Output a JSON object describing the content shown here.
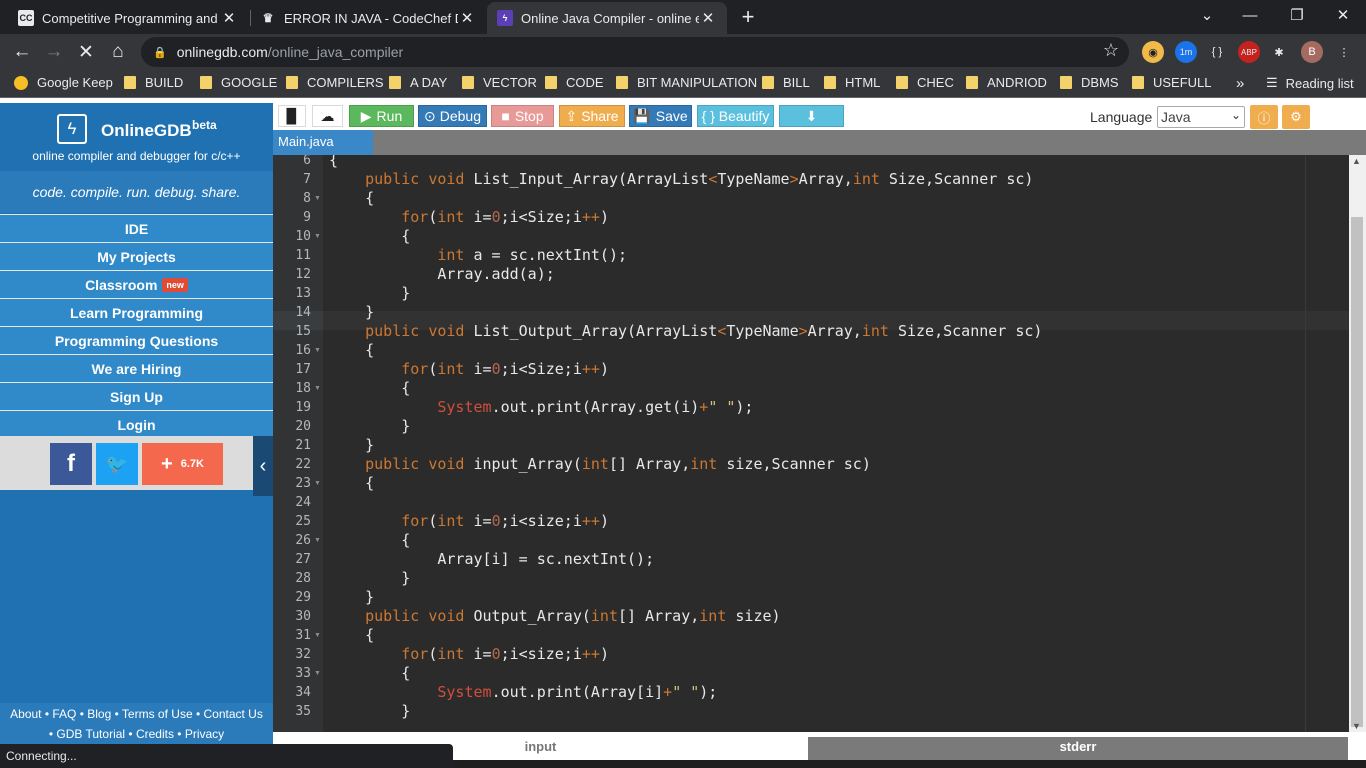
{
  "browser": {
    "tabs": [
      {
        "title": "Competitive Programming and C",
        "icon": "CC",
        "active": false
      },
      {
        "title": "ERROR IN JAVA - CodeChef Discu",
        "icon": "chef",
        "active": false
      },
      {
        "title": "Online Java Compiler - online ed",
        "icon": "bolt",
        "active": true
      }
    ],
    "url_host": "onlinegdb.com",
    "url_path": "/online_java_compiler",
    "extensions": [
      "1m",
      "ABP",
      "2",
      "B"
    ],
    "bookmarks": [
      "Google Keep",
      "BUILD",
      "GOOGLE",
      "COMPILERS",
      "A DAY",
      "VECTOR",
      "CODE",
      "BIT MANIPULATION",
      "BILL",
      "HTML",
      "CHEC",
      "ANDRIOD",
      "DBMS",
      "USEFULL"
    ],
    "reading_list": "Reading list",
    "more": "»",
    "status": "Connecting..."
  },
  "sidebar": {
    "brand": "OnlineGDB",
    "brand_sup": "beta",
    "subtitle": "online compiler and debugger for c/c++",
    "tagline": "code. compile. run. debug. share.",
    "menu": [
      {
        "label": "IDE"
      },
      {
        "label": "My Projects"
      },
      {
        "label": "Classroom",
        "badge": "new"
      },
      {
        "label": "Learn Programming"
      },
      {
        "label": "Programming Questions"
      },
      {
        "label": "We are Hiring"
      },
      {
        "label": "Sign Up"
      },
      {
        "label": "Login"
      }
    ],
    "share_count": "6.7K",
    "footer_line1": "About • FAQ • Blog • Terms of Use • Contact Us",
    "footer_line2": "• GDB Tutorial • Credits • Privacy"
  },
  "editor": {
    "toolbar": {
      "run": "Run",
      "debug": "Debug",
      "stop": "Stop",
      "share": "Share",
      "save": "Save",
      "beautify": "{ } Beautify"
    },
    "language_label": "Language",
    "language_value": "Java",
    "file_tab": "Main.java",
    "bottom_tabs": {
      "input": "input",
      "stderr": "stderr"
    },
    "lines": [
      {
        "n": "6",
        "text": "{"
      },
      {
        "n": "7",
        "text": "    public void List_Input_Array(ArrayList<TypeName>Array,int Size,Scanner sc)"
      },
      {
        "n": "8",
        "text": "    {"
      },
      {
        "n": "9",
        "text": "        for(int i=0;i<Size;i++)"
      },
      {
        "n": "10",
        "text": "        {"
      },
      {
        "n": "11",
        "text": "            int a = sc.nextInt();"
      },
      {
        "n": "12",
        "text": "            Array.add(a);"
      },
      {
        "n": "13",
        "text": "        }"
      },
      {
        "n": "14",
        "text": "    }"
      },
      {
        "n": "15",
        "text": "    public void List_Output_Array(ArrayList<TypeName>Array,int Size,Scanner sc)"
      },
      {
        "n": "16",
        "text": "    {"
      },
      {
        "n": "17",
        "text": "        for(int i=0;i<Size;i++)"
      },
      {
        "n": "18",
        "text": "        {"
      },
      {
        "n": "19",
        "text": "            System.out.print(Array.get(i)+\" \");"
      },
      {
        "n": "20",
        "text": "        }"
      },
      {
        "n": "21",
        "text": "    }"
      },
      {
        "n": "22",
        "text": "    public void input_Array(int[] Array,int size,Scanner sc)"
      },
      {
        "n": "23",
        "text": "    {"
      },
      {
        "n": "24",
        "text": ""
      },
      {
        "n": "25",
        "text": "        for(int i=0;i<size;i++)"
      },
      {
        "n": "26",
        "text": "        {"
      },
      {
        "n": "27",
        "text": "            Array[i] = sc.nextInt();"
      },
      {
        "n": "28",
        "text": "        }"
      },
      {
        "n": "29",
        "text": "    }"
      },
      {
        "n": "30",
        "text": "    public void Output_Array(int[] Array,int size)"
      },
      {
        "n": "31",
        "text": "    {"
      },
      {
        "n": "32",
        "text": "        for(int i=0;i<size;i++)"
      },
      {
        "n": "33",
        "text": "        {"
      },
      {
        "n": "34",
        "text": "            System.out.print(Array[i]+\" \");"
      },
      {
        "n": "35",
        "text": "        }"
      }
    ],
    "fold_lines": [
      "8",
      "10",
      "16",
      "18",
      "23",
      "26",
      "31",
      "33"
    ]
  },
  "colors": {
    "sidebar": "#1f71b1",
    "run": "#5cb85c",
    "debug": "#337ab7",
    "stop": "#d9534f",
    "share": "#f0ad4e",
    "save": "#337ab7",
    "beautify": "#5bc0de",
    "editor_bg": "#2b2b2b"
  }
}
